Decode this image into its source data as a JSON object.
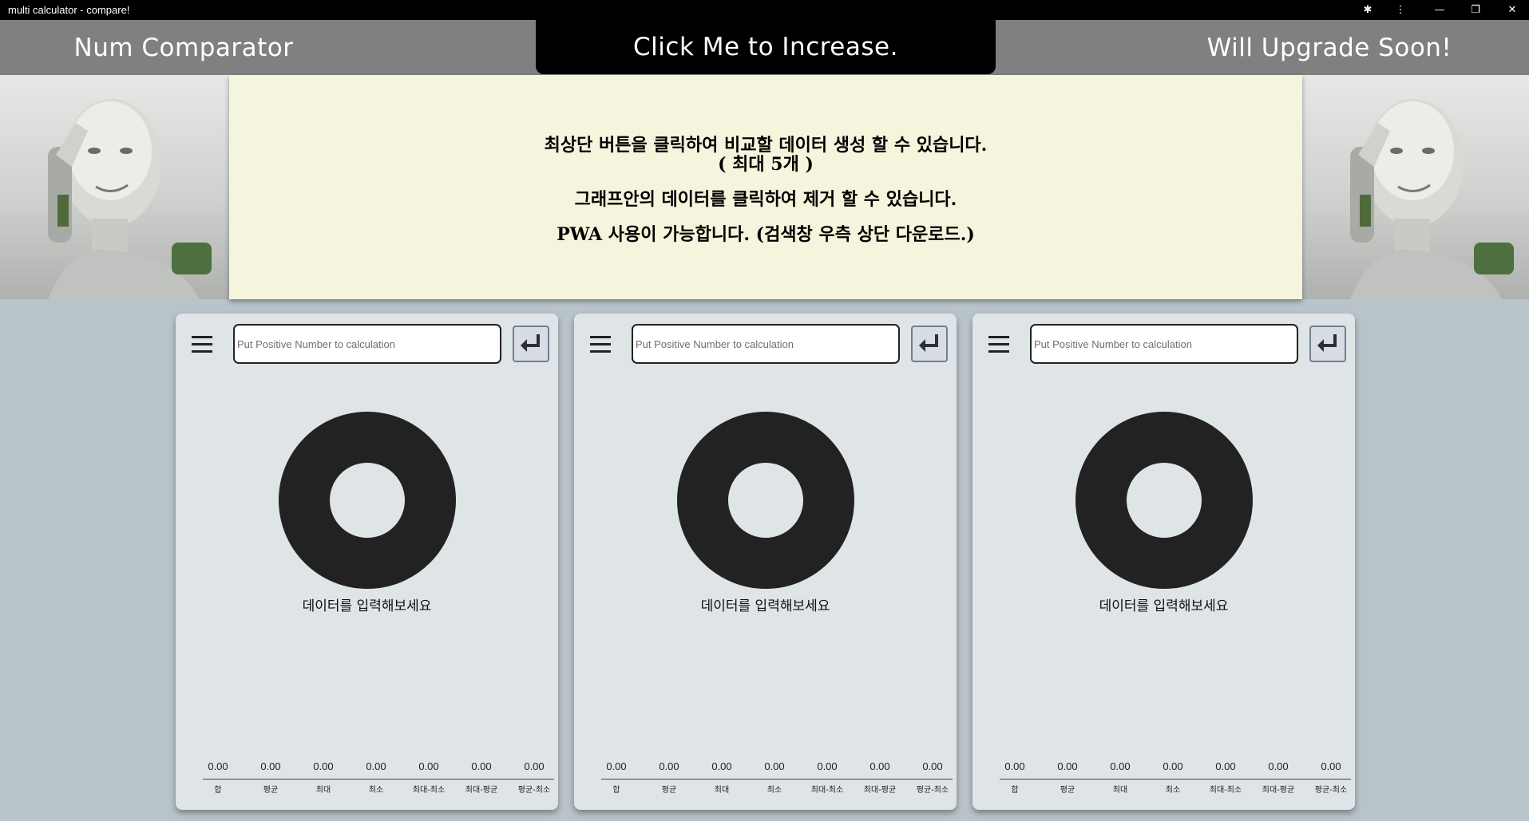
{
  "window": {
    "title": "multi calculator - compare!",
    "buttons": [
      {
        "name": "extensions",
        "glyph": "✱"
      },
      {
        "name": "more-menu",
        "glyph": "⋮"
      },
      {
        "name": "minimize",
        "glyph": "—"
      },
      {
        "name": "restore",
        "glyph": "❐"
      },
      {
        "name": "close",
        "glyph": "✕"
      }
    ]
  },
  "header": {
    "left": "Num Comparator",
    "center": "Click Me to Increase.",
    "right": "Will Upgrade Soon!"
  },
  "notice": {
    "line1": "최상단 버튼을 클릭하여 비교할 데이터 생성 할 수 있습니다.",
    "line2": "( 최대 5개 )",
    "line3": "그래프안의 데이터를 클릭하여 제거 할 수 있습니다.",
    "line4": "PWA 사용이 가능합니다. (검색창 우측 상단 다운로드.)"
  },
  "cards": [
    {
      "input_placeholder": "Put Positive Number to calculation",
      "empty_message": "데이터를 입력해보세요",
      "stats": [
        {
          "label": "합",
          "value": "0.00"
        },
        {
          "label": "평균",
          "value": "0.00"
        },
        {
          "label": "최대",
          "value": "0.00"
        },
        {
          "label": "최소",
          "value": "0.00"
        },
        {
          "label": "최대-최소",
          "value": "0.00"
        },
        {
          "label": "최대-평균",
          "value": "0.00"
        },
        {
          "label": "평균-최소",
          "value": "0.00"
        }
      ]
    },
    {
      "input_placeholder": "Put Positive Number to calculation",
      "empty_message": "데이터를 입력해보세요",
      "stats": [
        {
          "label": "합",
          "value": "0.00"
        },
        {
          "label": "평균",
          "value": "0.00"
        },
        {
          "label": "최대",
          "value": "0.00"
        },
        {
          "label": "최소",
          "value": "0.00"
        },
        {
          "label": "최대-최소",
          "value": "0.00"
        },
        {
          "label": "최대-평균",
          "value": "0.00"
        },
        {
          "label": "평균-최소",
          "value": "0.00"
        }
      ]
    },
    {
      "input_placeholder": "Put Positive Number to calculation",
      "empty_message": "데이터를 입력해보세요",
      "stats": [
        {
          "label": "합",
          "value": "0.00"
        },
        {
          "label": "평균",
          "value": "0.00"
        },
        {
          "label": "최대",
          "value": "0.00"
        },
        {
          "label": "최소",
          "value": "0.00"
        },
        {
          "label": "최대-최소",
          "value": "0.00"
        },
        {
          "label": "최대-평균",
          "value": "0.00"
        },
        {
          "label": "평균-최소",
          "value": "0.00"
        }
      ]
    }
  ],
  "colors": {
    "header_bg": "#808080",
    "header_center_bg": "#000000",
    "notice_bg": "#f5f4dc",
    "card_bg": "#dfe4e7",
    "page_bg": "#b9c3ca",
    "donut": "#222222"
  }
}
